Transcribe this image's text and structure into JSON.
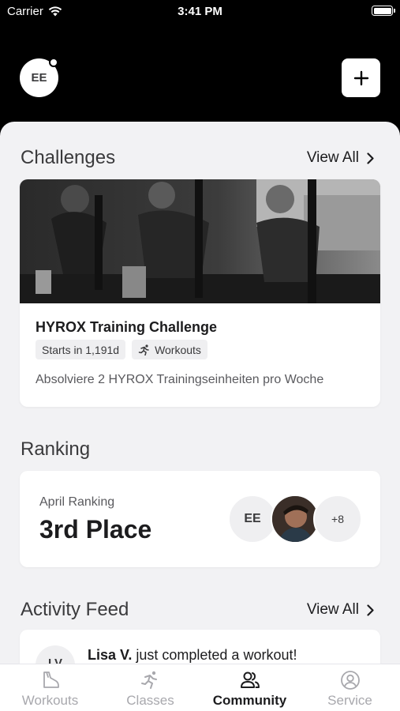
{
  "status_bar": {
    "carrier": "Carrier",
    "time": "3:41 PM"
  },
  "header": {
    "user_initials": "EE",
    "add_label": "+"
  },
  "challenges": {
    "title": "Challenges",
    "view_all": "View All",
    "card": {
      "title": "HYROX Training Challenge",
      "starts": "Starts in 1,191d",
      "type": "Workouts",
      "description": "Absolviere 2 HYROX Trainingseinheiten pro Woche"
    }
  },
  "ranking": {
    "title": "Ranking",
    "label": "April Ranking",
    "place": "3rd Place",
    "avatar_initials": "EE",
    "more_count": "+8"
  },
  "activity_feed": {
    "title": "Activity Feed",
    "view_all": "View All",
    "item": {
      "initials": "LV",
      "name": "Lisa V.",
      "text": " just completed a workout!"
    }
  },
  "tabs": [
    {
      "label": "Workouts",
      "icon": "shoe-icon",
      "active": false
    },
    {
      "label": "Classes",
      "icon": "runner-icon",
      "active": false
    },
    {
      "label": "Community",
      "icon": "people-icon",
      "active": true
    },
    {
      "label": "Service",
      "icon": "user-circle-icon",
      "active": false
    }
  ],
  "colors": {
    "background": "#000000",
    "sheet": "#f2f2f4",
    "active_tab": "#1c1c1e",
    "inactive_tab": "#a8a8ad"
  }
}
